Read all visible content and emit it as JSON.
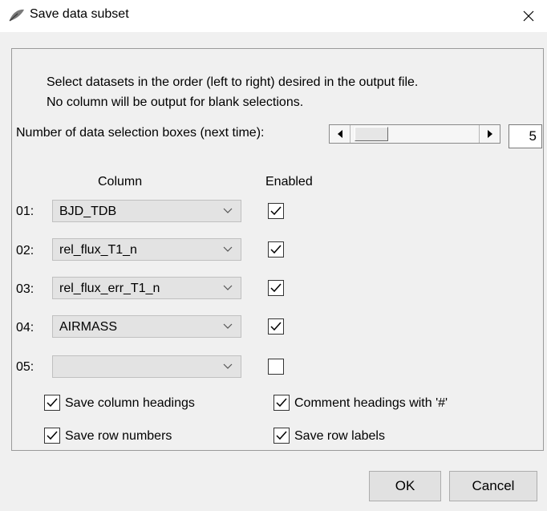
{
  "window": {
    "title": "Save data subset",
    "icon": "feather-icon"
  },
  "instructions": {
    "line1": "Select datasets in the order (left to right) desired in the output file.",
    "line2": "No column will be output for blank selections."
  },
  "selection_boxes": {
    "label": "Number of data selection boxes (next time):",
    "value": "5"
  },
  "columns_header": {
    "column": "Column",
    "enabled": "Enabled"
  },
  "rows": [
    {
      "label": "01:",
      "value": "BJD_TDB",
      "enabled": true
    },
    {
      "label": "02:",
      "value": "rel_flux_T1_n",
      "enabled": true
    },
    {
      "label": "03:",
      "value": "rel_flux_err_T1_n",
      "enabled": true
    },
    {
      "label": "04:",
      "value": "AIRMASS",
      "enabled": true
    },
    {
      "label": "05:",
      "value": "",
      "enabled": false
    }
  ],
  "options": {
    "save_column_headings": {
      "label": "Save column headings",
      "checked": true
    },
    "comment_headings": {
      "label": "Comment headings with '#'",
      "checked": true
    },
    "save_row_numbers": {
      "label": "Save row numbers",
      "checked": true
    },
    "save_row_labels": {
      "label": "Save row labels",
      "checked": true
    }
  },
  "buttons": {
    "ok": "OK",
    "cancel": "Cancel"
  }
}
